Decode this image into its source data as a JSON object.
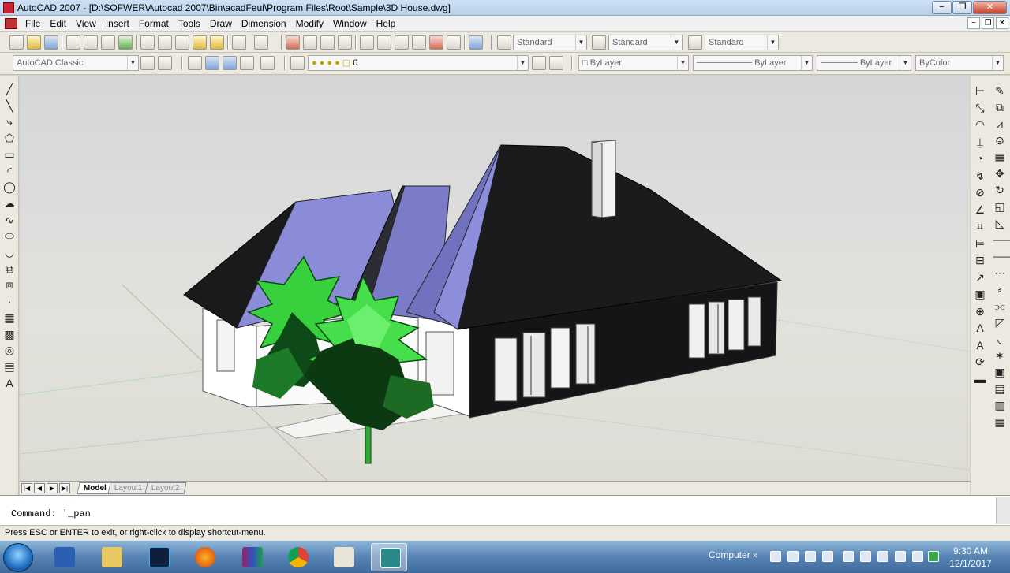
{
  "window": {
    "title": "AutoCAD 2007 - [D:\\SOFWER\\Autocad 2007\\Bin\\acadFeui\\Program Files\\Root\\Sample\\3D House.dwg]",
    "controls": {
      "minimize": "−",
      "restore": "❐",
      "close": "✕"
    }
  },
  "menu": {
    "items": [
      "File",
      "Edit",
      "View",
      "Insert",
      "Format",
      "Tools",
      "Draw",
      "Dimension",
      "Modify",
      "Window",
      "Help"
    ],
    "mdi_controls": {
      "minimize": "−",
      "restore": "❐",
      "close": "✕"
    }
  },
  "toolbar1": {
    "text_style": "Standard",
    "dim_style": "Standard",
    "table_style": "Standard"
  },
  "toolbar2": {
    "workspace": "AutoCAD Classic",
    "layer": "0",
    "color": "ByLayer",
    "linetype": "ByLayer",
    "lineweight": "ByLayer",
    "plotstyle": "ByColor"
  },
  "left_tools": [
    "line-icon",
    "construction-line-icon",
    "polyline-icon",
    "polygon-icon",
    "rectangle-icon",
    "arc-icon",
    "circle-icon",
    "revision-cloud-icon",
    "spline-icon",
    "ellipse-icon",
    "ellipse-arc-icon",
    "insert-block-icon",
    "make-block-icon",
    "point-icon",
    "hatch-icon",
    "gradient-icon",
    "region-icon",
    "table-icon",
    "multiline-text-icon"
  ],
  "left_tool_glyphs": [
    "╱",
    "╲",
    "⤷",
    "⬠",
    "▭",
    "◜",
    "◯",
    "☁",
    "∿",
    "⬭",
    "◡",
    "⧉",
    "⧈",
    "·",
    "▦",
    "▩",
    "◎",
    "▤",
    "A"
  ],
  "right_tools_1": [
    "linear-dim-icon",
    "aligned-dim-icon",
    "arc-length-icon",
    "ordinate-icon",
    "radius-icon",
    "jogged-icon",
    "diameter-icon",
    "angular-icon",
    "quick-dim-icon",
    "baseline-icon",
    "continue-icon",
    "quick-leader-icon",
    "tolerance-icon",
    "center-mark-icon",
    "dim-edit-icon",
    "dim-text-edit-icon",
    "dim-update-icon",
    "dim-style-icon"
  ],
  "right_tool_glyphs_1": [
    "⊢",
    "⤡",
    "◠",
    "⍊",
    "◔",
    "↯",
    "⊘",
    "∠",
    "⌗",
    "⊨",
    "⊟",
    "↗",
    "▣",
    "⊕",
    "A̲",
    "A",
    "⟳",
    "▬"
  ],
  "right_tools_2": [
    "erase-icon",
    "copy-icon",
    "mirror-icon",
    "offset-icon",
    "array-icon",
    "move-icon",
    "rotate-icon",
    "scale-icon",
    "stretch-icon",
    "trim-icon",
    "extend-icon",
    "break-point-icon",
    "break-icon",
    "join-icon",
    "chamfer-icon",
    "fillet-icon",
    "explode-icon",
    "draworder-front-icon",
    "draworder-back-icon",
    "draworder-above-icon",
    "draworder-under-icon"
  ],
  "right_tool_glyphs_2": [
    "✎",
    "⧉",
    "⩘",
    "⊜",
    "▦",
    "✥",
    "↻",
    "◱",
    "◺",
    "⸺",
    "⸻",
    "⋯",
    "⸗",
    "⫘",
    "◸",
    "◟",
    "✶",
    "▣",
    "▤",
    "▥",
    "▦"
  ],
  "layout_tabs": {
    "nav": [
      "|◀",
      "◀",
      "▶",
      "▶|"
    ],
    "tabs": [
      {
        "label": "Model",
        "active": true
      },
      {
        "label": "Layout1",
        "active": false
      },
      {
        "label": "Layout2",
        "active": false
      }
    ]
  },
  "command": {
    "line": "Command: '_pan"
  },
  "status": {
    "text": "Press ESC or ENTER to exit, or right-click to display shortcut-menu."
  },
  "taskbar": {
    "apps": [
      "word-icon",
      "explorer-icon",
      "photoshop-icon",
      "firefox-icon",
      "winrar-icon",
      "chrome-icon",
      "paint-icon",
      "autocad-icon"
    ],
    "tray_label": "Computer",
    "tray_chevron": "»",
    "time": "9:30 AM",
    "date": "12/1/2017"
  },
  "colors": {
    "titlebar": "#c4d8ee",
    "roof_dark": "#1a1a1c",
    "roof_light": "#8a8cd8",
    "tree_light": "#39d03e",
    "tree_dark": "#0b3a12",
    "wall": "#ffffff"
  }
}
